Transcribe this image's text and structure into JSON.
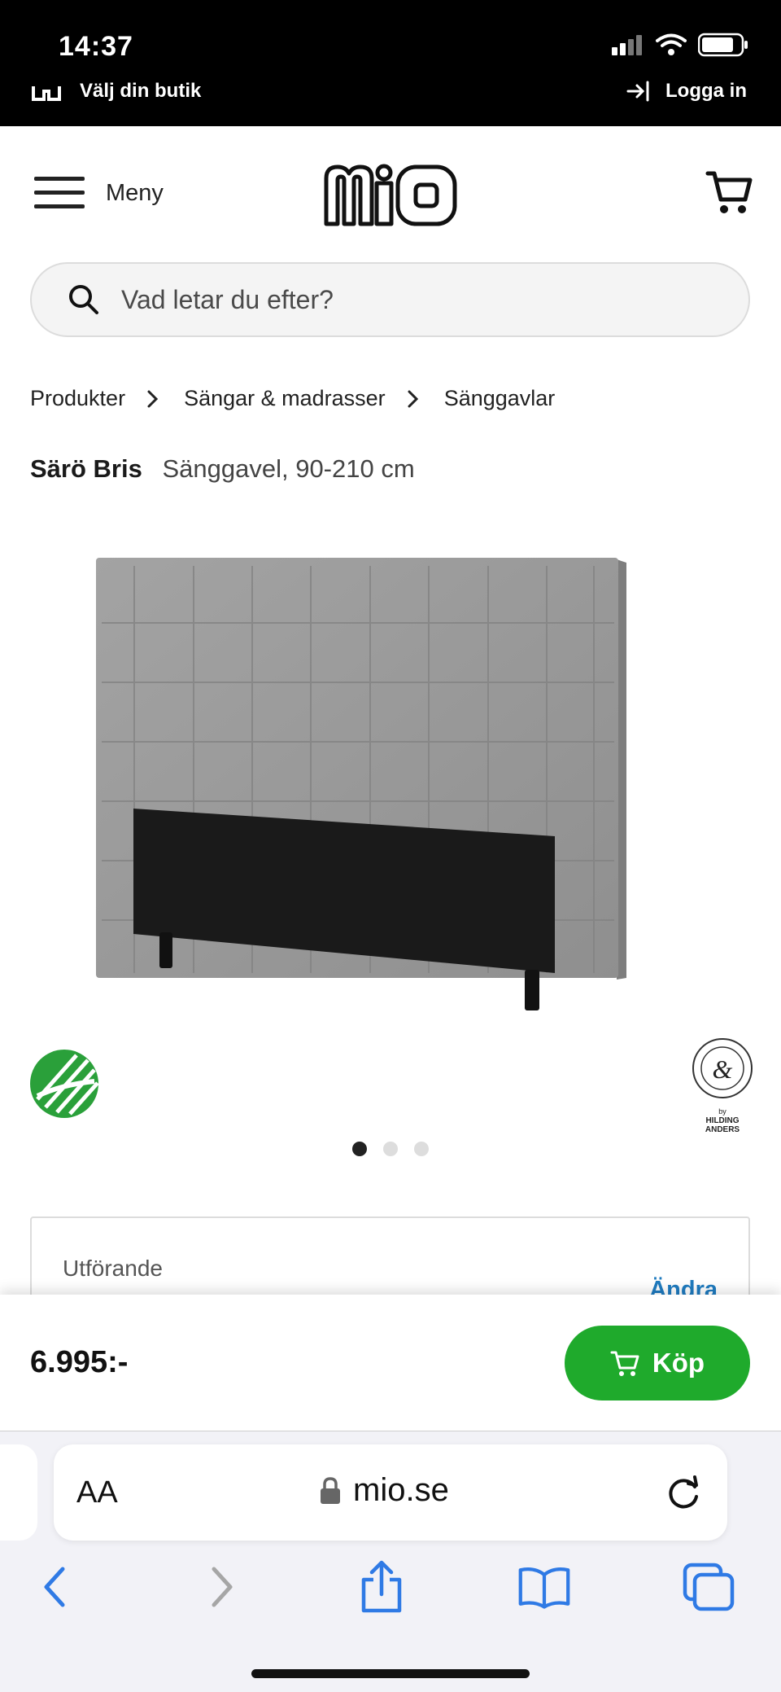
{
  "status_bar": {
    "time": "14:37"
  },
  "store_bar": {
    "store_label": "Välj din butik",
    "login_label": "Logga in"
  },
  "header": {
    "menu_label": "Meny",
    "logo_text": "mio"
  },
  "search": {
    "placeholder": "Vad letar du efter?"
  },
  "breadcrumb": [
    "Produkter",
    "Sängar & madrasser",
    "Sänggavlar"
  ],
  "product": {
    "brand": "Särö Bris",
    "description": "Sänggavel, 90-210 cm",
    "image_count": 3,
    "active_image": 0,
    "hilding_badge_text": "HILDING ANDERS",
    "hilding_badge_by": "by"
  },
  "variant": {
    "label": "Utförande",
    "change_label": "Ändra"
  },
  "buy": {
    "price": "6.995:-",
    "button_label": "Köp"
  },
  "browser": {
    "aa_label": "AA",
    "url": "mio.se"
  },
  "colors": {
    "brand_green": "#1faa2c",
    "link_blue": "#1f7bbf",
    "ios_blue": "#2f7ae5"
  }
}
